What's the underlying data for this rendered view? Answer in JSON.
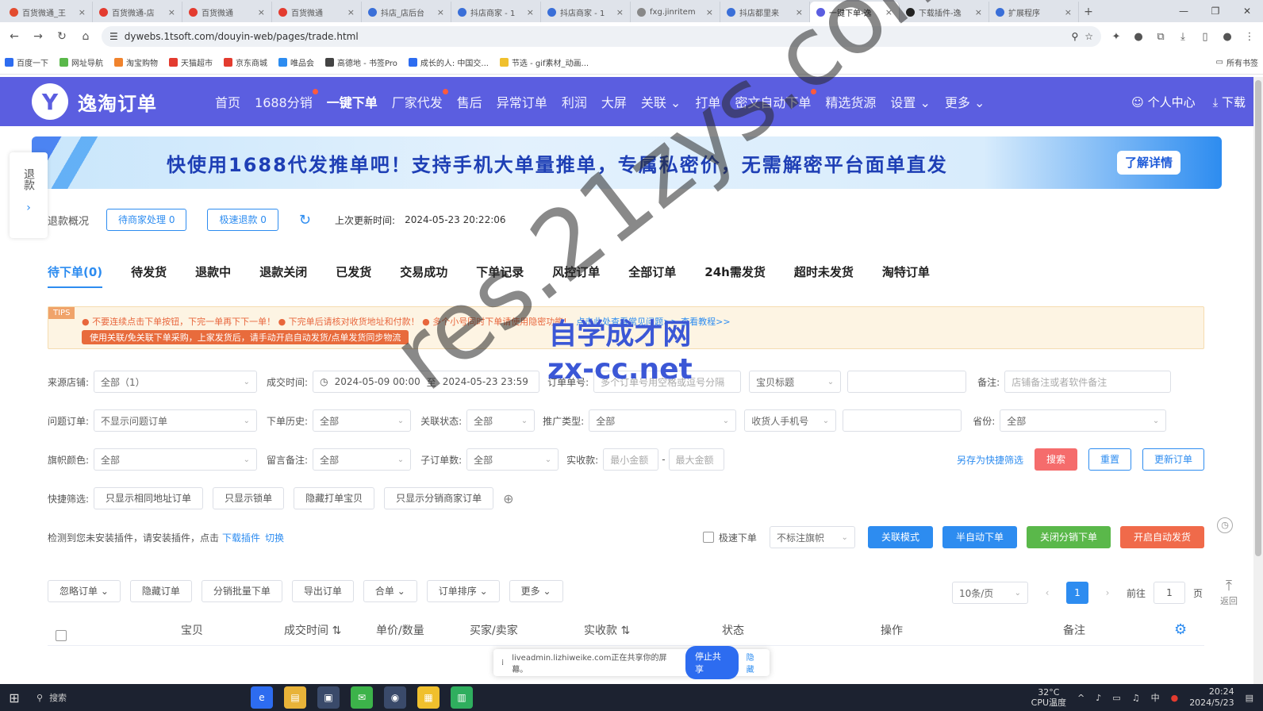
{
  "browser": {
    "tabs": [
      {
        "label": "百货微通_王",
        "color": "#e34c2f",
        "active": false
      },
      {
        "label": "百货微通-店",
        "color": "#e33b2f",
        "active": false
      },
      {
        "label": "百货微通",
        "color": "#e33b2f",
        "active": false
      },
      {
        "label": "百货微通",
        "color": "#e33b2f",
        "active": false
      },
      {
        "label": "抖店_店后台",
        "color": "#3a6fd8",
        "active": false
      },
      {
        "label": "抖店商家 - 1",
        "color": "#3a6fd8",
        "active": false
      },
      {
        "label": "抖店商家 - 1",
        "color": "#3a6fd8",
        "active": false
      },
      {
        "label": "fxg.jinritem",
        "color": "#888888",
        "active": false
      },
      {
        "label": "抖店都里来",
        "color": "#3a6fd8",
        "active": false
      },
      {
        "label": "一键下单-逸",
        "color": "#5b5ee0",
        "active": true
      },
      {
        "label": "下载插件-逸",
        "color": "#222222",
        "active": false
      },
      {
        "label": "扩展程序",
        "color": "#3a6fd8",
        "active": false
      }
    ],
    "url": "dywebs.1tsoft.com/douyin-web/pages/trade.html",
    "bookmarks": [
      {
        "label": "百度一下",
        "color": "#2d6cf0"
      },
      {
        "label": "网址导航",
        "color": "#5ab84a"
      },
      {
        "label": "淘宝购物",
        "color": "#f0832d"
      },
      {
        "label": "天猫超市",
        "color": "#e33b2f"
      },
      {
        "label": "京东商城",
        "color": "#e33b2f"
      },
      {
        "label": "唯品会",
        "color": "#2d8cf0"
      },
      {
        "label": "高德地 - 书签Pro",
        "color": "#444444"
      },
      {
        "label": "成长的人: 中国交...",
        "color": "#2d6cf0"
      },
      {
        "label": "节选 - gif素材_动画...",
        "color": "#f0c02d"
      }
    ],
    "bookmarks_folder": "所有书签"
  },
  "app": {
    "logo_text": "逸淘订单",
    "nav": [
      {
        "label": "首页",
        "active": false,
        "dot": false
      },
      {
        "label": "1688分销",
        "active": false,
        "dot": true
      },
      {
        "label": "一键下单",
        "active": true,
        "dot": false
      },
      {
        "label": "厂家代发",
        "active": false,
        "dot": true
      },
      {
        "label": "售后",
        "active": false,
        "dot": false
      },
      {
        "label": "异常订单",
        "active": false,
        "dot": false
      },
      {
        "label": "利润",
        "active": false,
        "dot": false
      },
      {
        "label": "大屏",
        "active": false,
        "dot": false
      },
      {
        "label": "关联 ⌄",
        "active": false,
        "dot": false
      },
      {
        "label": "打单",
        "active": false,
        "dot": false
      },
      {
        "label": "密文自动下单",
        "active": false,
        "dot": true
      },
      {
        "label": "精选货源",
        "active": false,
        "dot": false
      },
      {
        "label": "设置 ⌄",
        "active": false,
        "dot": false
      },
      {
        "label": "更多 ⌄",
        "active": false,
        "dot": false
      }
    ],
    "personal_center": "个人中心",
    "download": "下载"
  },
  "banner": {
    "text": "快使用1688代发推单吧！支持手机大单量推单，专属私密价，无需解密平台面单直发",
    "button": "了解详情"
  },
  "sidedock": {
    "label": "退款"
  },
  "refund": {
    "title": "退款概况",
    "pending": "待商家处理 0",
    "fast": "极速退款 0",
    "last_update_label": "上次更新时间:",
    "last_update_value": "2024-05-23 20:22:06"
  },
  "status_tabs": [
    "待下单(0)",
    "待发货",
    "退款中",
    "退款关闭",
    "已发货",
    "交易成功",
    "下单记录",
    "风控订单",
    "全部订单",
    "24h需发货",
    "超时未发货",
    "淘特订单"
  ],
  "tips": {
    "tag": "TIPS",
    "line1": "● 不要连续点击下单按钮，下完一单再下下一单！  ● 下完单后请核对收货地址和付款！  ● 多个小号同时下单请使用隐密功能!",
    "line1_link": "点击此处查看常见问题>>  查看教程>>",
    "line2": "使用关联/免关联下单采购，上家发货后，请手动开启自动发货/点单发货同步物流"
  },
  "filters": {
    "shop_label": "来源店铺:",
    "shop_value": "全部（1）",
    "time_label": "成交时间:",
    "time_start": "2024-05-09 00:00",
    "time_to": "至",
    "time_end": "2024-05-23 23:59",
    "order_no_label": "订单单号:",
    "order_no_placeholder": "多个订单号用空格或逗号分隔",
    "title_select": "宝贝标题",
    "remark_label": "备注:",
    "remark_placeholder": "店铺备注或者软件备注",
    "problem_label": "问题订单:",
    "problem_value": "不显示问题订单",
    "history_label": "下单历史:",
    "history_value": "全部",
    "relation_label": "关联状态:",
    "relation_value": "全部",
    "promo_label": "推广类型:",
    "promo_value": "全部",
    "phone_select": "收货人手机号",
    "province_label": "省份:",
    "province_value": "全部",
    "flag_label": "旗帜颜色:",
    "flag_value": "全部",
    "message_label": "留言备注:",
    "message_value": "全部",
    "suborder_label": "子订单数:",
    "suborder_value": "全部",
    "amount_label": "实收款:",
    "amount_min": "最小金额",
    "amount_dash": "-",
    "amount_max": "最大金额",
    "save_quick": "另存为快捷筛选",
    "search_btn": "搜索",
    "reset_btn": "重置",
    "update_btn": "更新订单",
    "quick_label": "快捷筛选:",
    "quick_1": "只显示相同地址订单",
    "quick_2": "只显示锁单",
    "quick_3": "隐藏打单宝贝",
    "quick_4": "只显示分销商家订单"
  },
  "plugin": {
    "notice": "检测到您未安装插件，请安装插件，点击",
    "download_link": "下载插件",
    "switch_link": "切换",
    "fast_order": "极速下单",
    "no_mark": "不标注旗帜",
    "btn_relation": "关联模式",
    "btn_half_auto": "半自动下单",
    "btn_close_dist": "关闭分销下单",
    "btn_auto_ship": "开启自动发货"
  },
  "actions": {
    "ignore": "忽略订单 ⌄",
    "hide": "隐藏订单",
    "batch": "分销批量下单",
    "export": "导出订单",
    "merge": "合单 ⌄",
    "sort": "订单排序 ⌄",
    "more": "更多 ⌄"
  },
  "pager": {
    "page_size": "10条/页",
    "current": "1",
    "goto_label": "前往",
    "goto_value": "1",
    "page_unit": "页"
  },
  "table_header": {
    "item": "宝贝",
    "time": "成交时间 ⇅",
    "price": "单价/数量",
    "buyer": "买家/卖家",
    "paid": "实收款 ⇅",
    "status": "状态",
    "op": "操作",
    "remark": "备注"
  },
  "backtop": "返回",
  "sharebar": {
    "text": "liveadmin.lizhiweike.com正在共享你的屏幕。",
    "stop": "停止共享",
    "hide": "隐藏"
  },
  "watermark": {
    "main": "res.21zys.com",
    "cn": "自学成才网",
    "en": "zx-cc.net"
  },
  "taskbar": {
    "search": "搜索",
    "weather": "32°C",
    "weather_desc": "CPU温度",
    "time": "20:24",
    "date": "2024/5/23"
  }
}
